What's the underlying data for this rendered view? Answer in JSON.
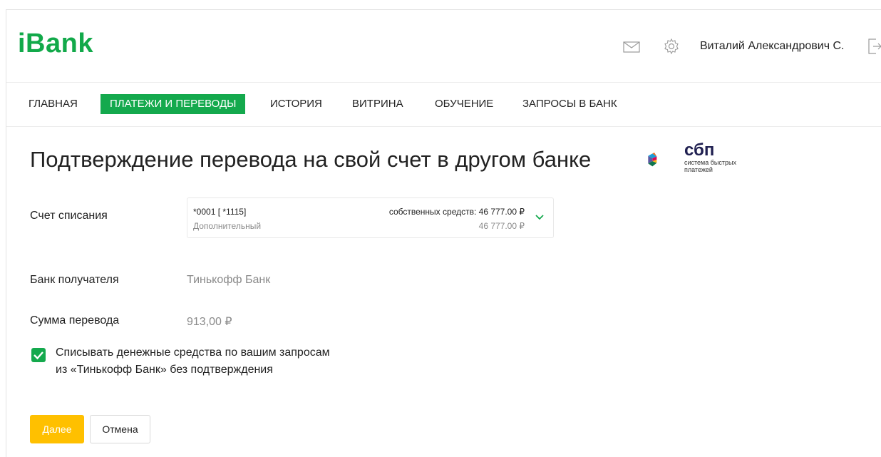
{
  "header": {
    "logo": "iBank",
    "user_name": "Виталий Александрович С.",
    "icons": [
      "mail-icon",
      "gear-icon",
      "exit-icon"
    ]
  },
  "nav": {
    "items": [
      {
        "label": "Главная",
        "active": false
      },
      {
        "label": "Платежи и переводы",
        "active": true
      },
      {
        "label": "История",
        "active": false
      },
      {
        "label": "Витрина",
        "active": false
      },
      {
        "label": "Обучение",
        "active": false
      },
      {
        "label": "Запросы в банк",
        "active": false
      }
    ]
  },
  "page": {
    "title": "Подтверждение перевода на свой счет в другом банке",
    "sbp": {
      "word": "сбп",
      "subtitle": "система быстрых платежей"
    }
  },
  "form": {
    "account_label": "Счет списания",
    "account": {
      "number": "*0001 [ *1115]",
      "type": "Дополнительный",
      "own_funds": "собственных средств: 46 777.00 ₽",
      "balance": "46 777.00 ₽"
    },
    "bank_label": "Банк получателя",
    "bank_value": "Тинькофф Банк",
    "amount_label": "Сумма перевода",
    "amount_value": "913,00 ₽",
    "consent_checked": true,
    "consent_text_line1": "Списывать денежные средства по вашим запросам",
    "consent_text_line2": "из «Тинькофф Банк» без подтверждения"
  },
  "buttons": {
    "next": "Далее",
    "cancel": "Отмена"
  },
  "colors": {
    "brand": "#14a94d",
    "primary_button": "#ffc000"
  }
}
